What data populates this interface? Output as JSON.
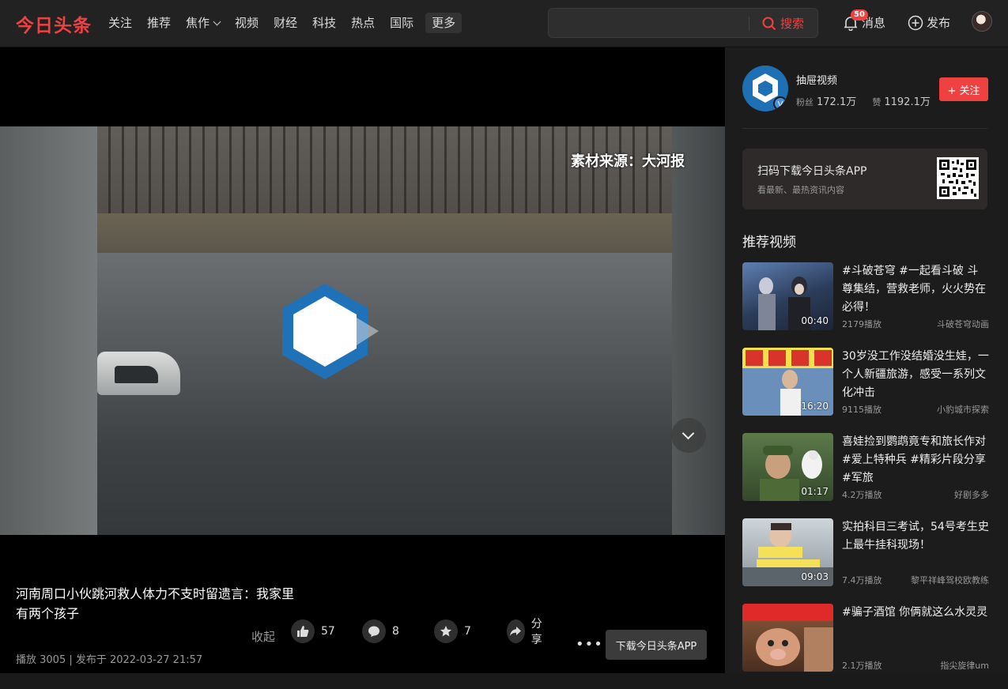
{
  "brand": {
    "name": "今日头条",
    "accent": "#f04142"
  },
  "nav": {
    "items": [
      "关注",
      "推荐",
      "焦作",
      "视频",
      "财经",
      "科技",
      "热点",
      "国际"
    ],
    "more": "更多"
  },
  "search": {
    "value": "",
    "button": "搜索"
  },
  "header": {
    "messages_label": "消息",
    "messages_badge": "50",
    "publish_label": "发布"
  },
  "player": {
    "watermark": "素材来源：大河报"
  },
  "video": {
    "title": "河南周口小伙跳河救人体力不支时留遗言：我家里有两个孩子",
    "collapse_label": "收起",
    "meta": "播放 3005 | 发布于 2022-03-27 21:57",
    "likes": "57",
    "comments": "8",
    "favorites": "7",
    "share_label": "分享",
    "more_label": "•••",
    "download_button": "下载今日头条APP"
  },
  "author": {
    "name": "抽屉视频",
    "fans_label": "粉丝",
    "fans": "172.1万",
    "likes_label": "赞",
    "likes": "1192.1万",
    "follow_button": "+ 关注"
  },
  "app_promo": {
    "title": "扫码下载今日头条APP",
    "subtitle": "看最新、最热资讯内容"
  },
  "recommended": {
    "heading": "推荐视频",
    "items": [
      {
        "title": "#斗破苍穹 #一起看斗破 斗尊集结，营救老师，火火势在必得！",
        "duration": "00:40",
        "plays": "2179播放",
        "source": "斗破苍穹动画"
      },
      {
        "title": "30岁没工作没结婚没生娃，一个人新疆旅游，感受一系列文化冲击",
        "duration": "16:20",
        "plays": "9115播放",
        "source": "小豹城市探索"
      },
      {
        "title": "喜娃捡到鹦鹉竟专和旅长作对#爱上特种兵 #精彩片段分享 #军旅",
        "duration": "01:17",
        "plays": "4.2万播放",
        "source": "好剧多多"
      },
      {
        "title": "实拍科目三考试，54号考生史上最牛挂科现场！",
        "duration": "09:03",
        "plays": "7.4万播放",
        "source": "黎平祥峰驾校欧教练"
      },
      {
        "title": "#骗子酒馆 你俩就这么水灵灵",
        "duration": "",
        "plays": "2.1万播放",
        "source": "指尖旋律um"
      }
    ]
  }
}
